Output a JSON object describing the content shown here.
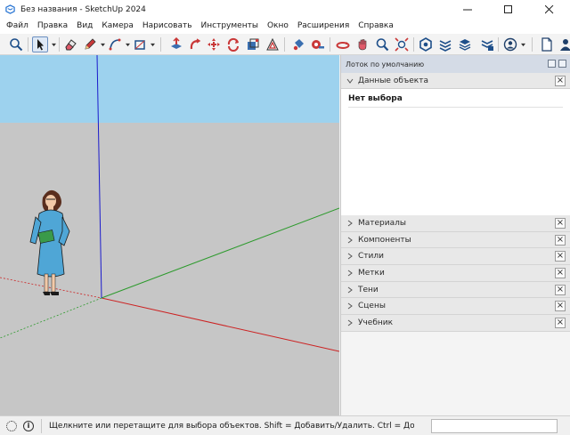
{
  "window": {
    "title": "Без названия - SketchUp 2024"
  },
  "menu": [
    "Файл",
    "Правка",
    "Вид",
    "Камера",
    "Нарисовать",
    "Инструменты",
    "Окно",
    "Расширения",
    "Справка"
  ],
  "tray": {
    "title": "Лоток по умолчанию",
    "entity_info": {
      "label": "Данные объекта",
      "selection_text": "Нет выбора"
    },
    "panels": [
      "Материалы",
      "Компоненты",
      "Стили",
      "Метки",
      "Тени",
      "Сцены",
      "Учебник"
    ]
  },
  "status": {
    "hint": "Щелкните или перетащите для выбора объектов. Shift = Добавить/Удалить. Ctrl = Добавить. Sh...",
    "info_icon": "i"
  },
  "colors": {
    "sky": "#9dd2ee",
    "ground": "#c6c6c6",
    "axis_red": "#cc2222",
    "axis_green": "#2c9a2c",
    "axis_blue": "#1a1acc",
    "accent": "#1f6fd1"
  }
}
